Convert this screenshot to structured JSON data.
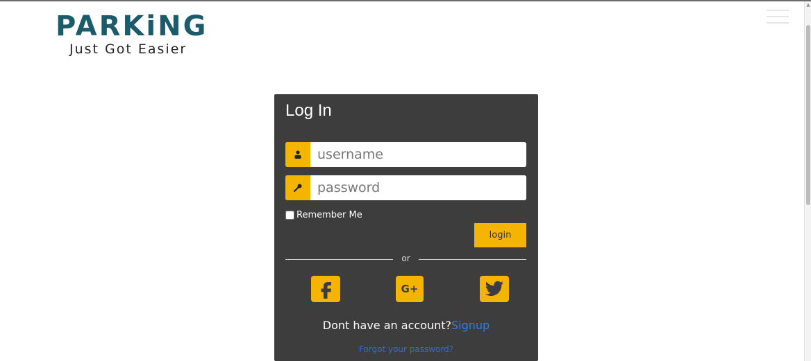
{
  "brand": {
    "title": "PARKiNG",
    "tagline": "Just Got Easier",
    "title_color": "#1d5a6a",
    "dot_color": "#4fb27b"
  },
  "login_form": {
    "heading": "Log In",
    "username_placeholder": "username",
    "password_placeholder": "password",
    "username_icon": "user-icon",
    "password_icon": "key-icon",
    "remember_label": "Remember Me",
    "remember_checked": false,
    "login_label": "login",
    "divider_text": "or",
    "social": [
      {
        "name": "facebook",
        "icon": "facebook-icon"
      },
      {
        "name": "google-plus",
        "icon": "google-plus-icon",
        "text": "G+"
      },
      {
        "name": "twitter",
        "icon": "twitter-icon"
      }
    ],
    "signup_prompt": "Dont have an account?",
    "signup_link": "Signup",
    "forgot_link": "Forgot your password?"
  },
  "colors": {
    "panel_bg": "#3d3d3d",
    "accent": "#f5b400",
    "link": "#2f7fe0"
  },
  "menu_icon": "hamburger-menu-icon"
}
